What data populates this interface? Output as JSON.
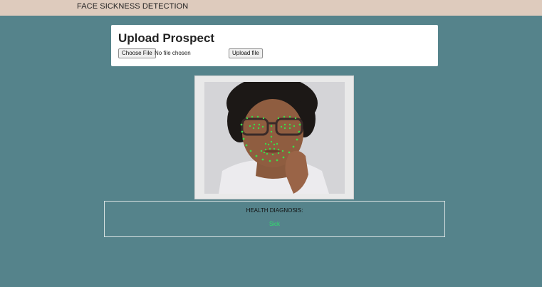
{
  "header": {
    "brand": "FACE SICKNESS DETECTION"
  },
  "upload": {
    "title": "Upload Prospect",
    "choose_label": "Choose File",
    "file_status": "No file chosen",
    "upload_label": "Upload file"
  },
  "result": {
    "label": "HEALTH DIAGNOSIS:",
    "value": "Sick"
  },
  "colors": {
    "background": "#55838b",
    "navbar": "#decbbd",
    "diagnosis_value": "#2fe26b",
    "landmark": "#3ddc4a"
  },
  "icons": {
    "photo": "face-landmark-photo"
  }
}
